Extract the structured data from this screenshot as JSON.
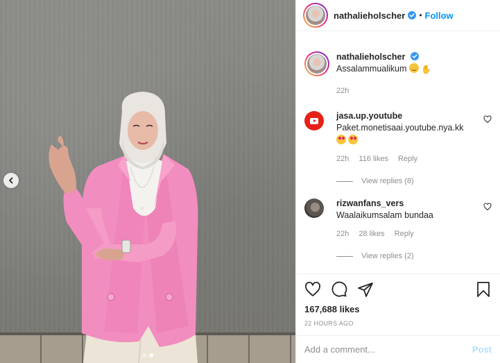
{
  "header": {
    "username": "nathalieholscher",
    "separator": "•",
    "follow_label": "Follow",
    "verified_icon": "verified-badge-icon"
  },
  "caption": {
    "username": "nathalieholscher",
    "text": "Assalammualikum",
    "emojis": [
      "smiling-face-icon",
      "folded-hands-icon"
    ],
    "time": "22h"
  },
  "comments": [
    {
      "username": "jasa.up.youtube",
      "text": "Paket.monetisaai.youtube.nya.kk",
      "emojis": [
        "heart-eyes-icon",
        "heart-eyes-icon"
      ],
      "time": "22h",
      "likes": "116 likes",
      "reply_label": "Reply",
      "view_replies": "View replies (8)"
    },
    {
      "username": "rizwanfans_vers",
      "text": "Waalaikumsalam bundaa",
      "time": "22h",
      "likes": "28 likes",
      "reply_label": "Reply",
      "view_replies": "View replies (2)"
    }
  ],
  "post": {
    "likes": "167,688 likes",
    "timestamp": "22 HOURS AGO"
  },
  "composer": {
    "placeholder": "Add a comment...",
    "post_label": "Post"
  },
  "carousel": {
    "slide_count": 2,
    "active_slide": 2
  },
  "colors": {
    "accent": "#0095f6",
    "post_disabled": "#b2dffc",
    "muted": "#8e8e8e",
    "text": "#262626",
    "blazer": "#f28dc0"
  }
}
